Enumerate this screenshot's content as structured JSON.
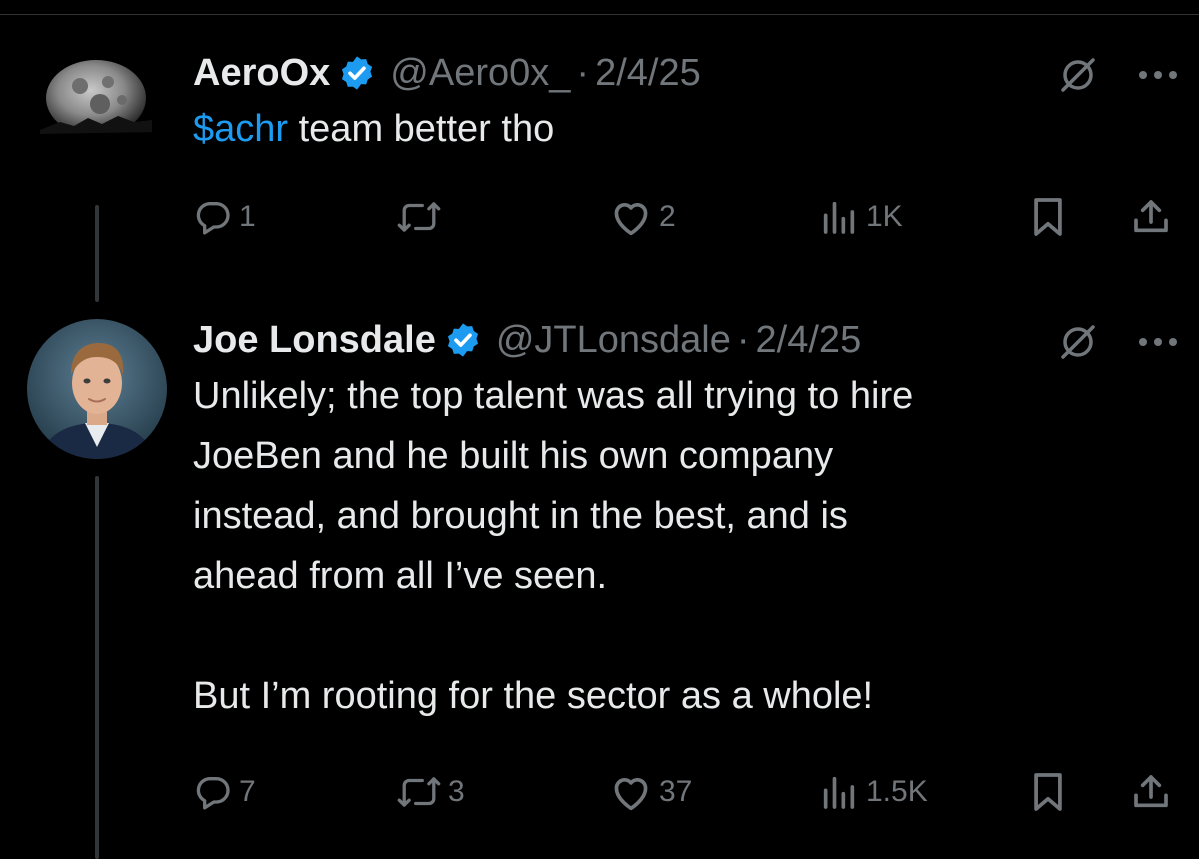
{
  "tweets": [
    {
      "author_name": "AeroOx",
      "handle": "@Aero0x_",
      "separator": "·",
      "date": "2/4/25",
      "text_cashtag": "$achr",
      "text_rest": " team better tho",
      "replies": "1",
      "retweets": "",
      "likes": "2",
      "views": "1K"
    },
    {
      "author_name": "Joe Lonsdale",
      "handle": "@JTLonsdale",
      "separator": "·",
      "date": "2/4/25",
      "text": "Unlikely; the top talent was all trying to hire\nJoeBen and he built his own company\ninstead, and brought in the best, and is\nahead from all I’ve seen.\n\nBut I’m rooting for the sector as a whole!",
      "replies": "7",
      "retweets": "3",
      "likes": "37",
      "views": "1.5K"
    }
  ],
  "colors": {
    "background": "#000000",
    "text": "#e7e9ea",
    "secondary": "#71767b",
    "accent": "#1d9bf0",
    "thread_line": "#333639"
  },
  "icons": [
    "verified-badge-icon",
    "grok-icon",
    "more-icon",
    "reply-icon",
    "retweet-icon",
    "like-icon",
    "views-icon",
    "bookmark-icon",
    "share-icon"
  ]
}
